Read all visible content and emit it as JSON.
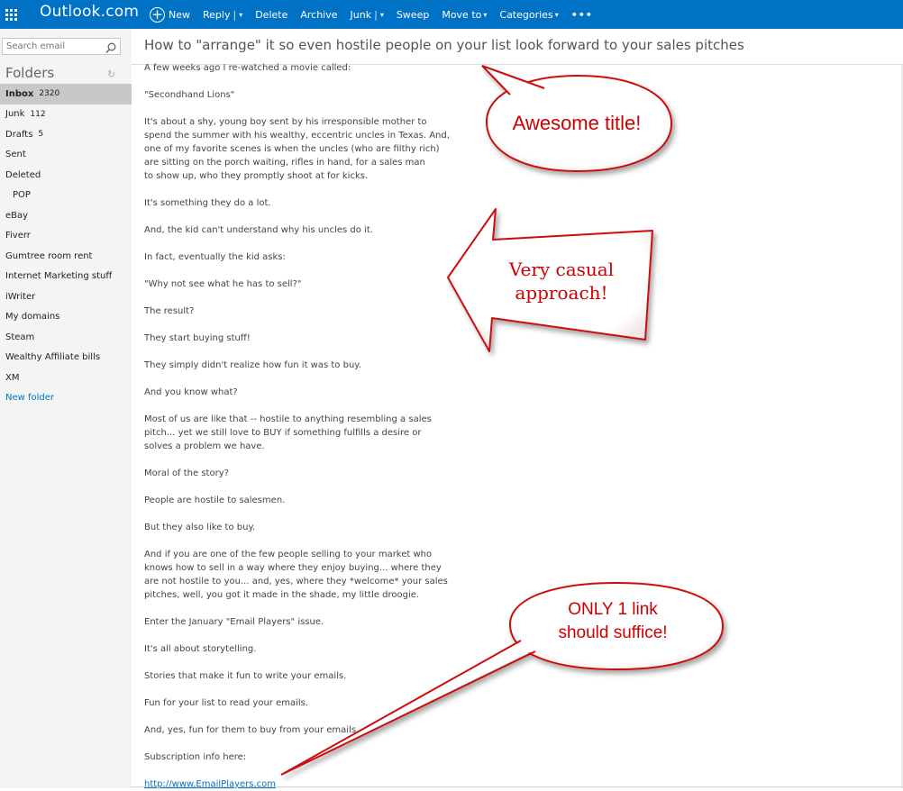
{
  "app": {
    "brand": "Outlook.com"
  },
  "toolbar": {
    "new": "New",
    "reply": "Reply",
    "delete": "Delete",
    "archive": "Archive",
    "junk": "Junk",
    "sweep": "Sweep",
    "move_to": "Move to",
    "categories": "Categories",
    "more": "•••",
    "split_sep": "|",
    "caret": "▾"
  },
  "search": {
    "placeholder": "Search email"
  },
  "folders": {
    "heading": "Folders",
    "refresh_glyph": "↻",
    "items": [
      {
        "label": "Inbox",
        "count": "2320"
      },
      {
        "label": "Junk",
        "count": "112"
      },
      {
        "label": "Drafts",
        "count": "5"
      },
      {
        "label": "Sent",
        "count": ""
      },
      {
        "label": "Deleted",
        "count": ""
      },
      {
        "label": "POP",
        "count": ""
      },
      {
        "label": "eBay",
        "count": ""
      },
      {
        "label": "Fiverr",
        "count": ""
      },
      {
        "label": "Gumtree room rent",
        "count": ""
      },
      {
        "label": "Internet Marketing stuff",
        "count": ""
      },
      {
        "label": "iWriter",
        "count": ""
      },
      {
        "label": "My domains",
        "count": ""
      },
      {
        "label": "Steam",
        "count": ""
      },
      {
        "label": "Wealthy Affiliate bills",
        "count": ""
      },
      {
        "label": "XM",
        "count": ""
      }
    ],
    "new_folder": "New folder"
  },
  "message": {
    "subject": "How to \"arrange\" it so even hostile people on your list look forward to your sales pitches",
    "paragraphs": [
      "A few weeks ago I re-watched a movie called:",
      "\"Secondhand Lions\"",
      "It's about a shy, young boy sent by his irresponsible mother to\nspend the summer with his wealthy, eccentric uncles in Texas. And,\none of my favorite scenes is when the uncles (who are filthy rich)\nare sitting on the porch waiting, rifles in hand, for a sales man\nto show up, who they promptly shoot at for kicks.",
      "It's something they do a lot.",
      "And, the kid can't understand why his uncles do it.",
      "In fact, eventually the kid asks:",
      "\"Why not see what he has to sell?\"",
      "The result?",
      "They start buying stuff!",
      "They simply didn't realize how fun it was to buy.",
      "And you know what?",
      "Most of us are like that -- hostile to anything resembling a sales\npitch... yet we still love to BUY if something fulfills a desire or\nsolves a problem we have.",
      "Moral of the story?",
      "People are hostile to salesmen.",
      "But they also like to buy.",
      "And if you are one of the few people selling to your market who\nknows how to sell in a way where they enjoy buying... where they\nare not hostile to you... and, yes, where they *welcome* your sales\npitches, well, you got it made in the shade, my little droogie.",
      "Enter the January \"Email Players\" issue.",
      "It's all about storytelling.",
      "Stories that make it fun to write your emails.",
      "Fun for your list to read your emails.",
      "And, yes, fun for them to buy from your emails.",
      "Subscription info here:"
    ],
    "link": "http://www.EmailPlayers.com"
  },
  "annotations": {
    "title_callout": "Awesome title!",
    "arrow_callout": "Very casual\napproach!",
    "link_callout": "ONLY 1 link\nshould suffice!",
    "color": "#cc0000"
  }
}
